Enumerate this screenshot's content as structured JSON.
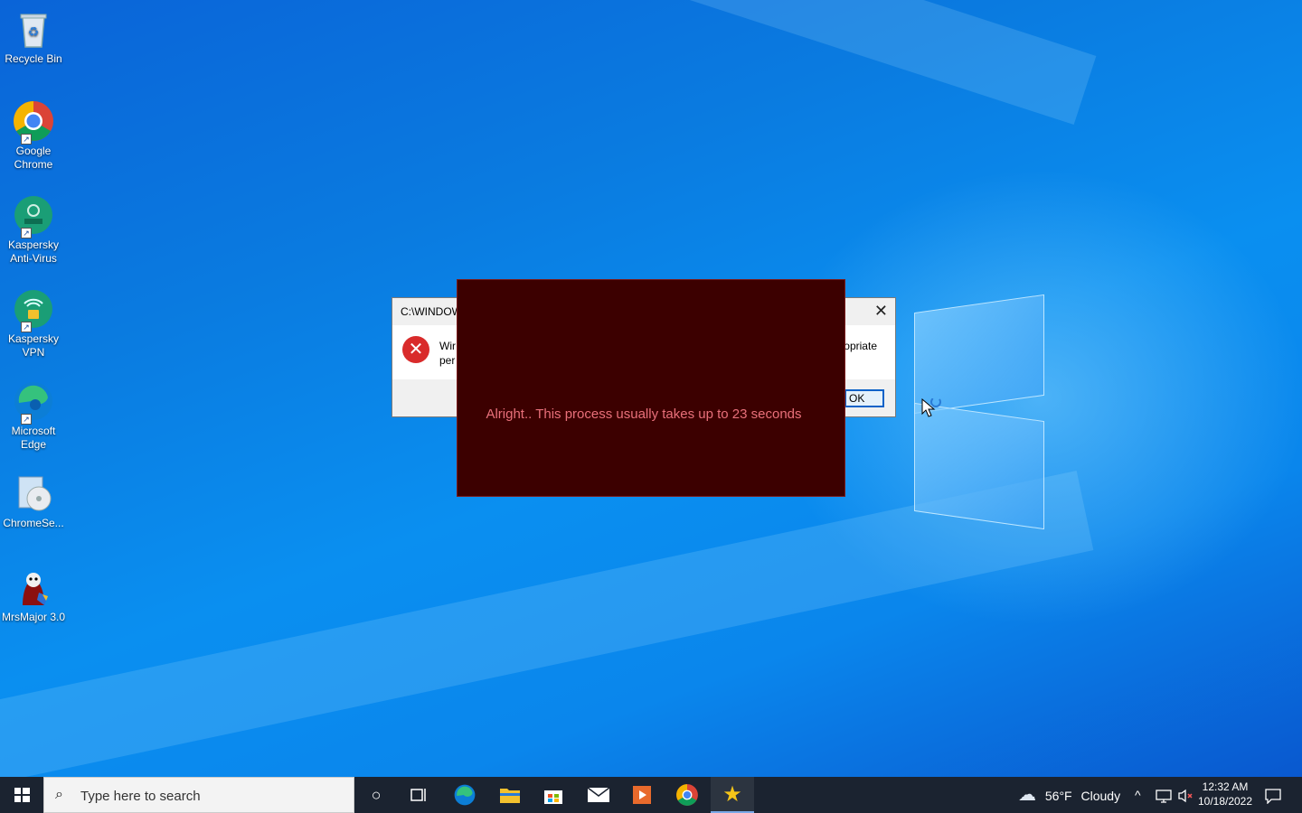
{
  "desktop": {
    "icons": [
      {
        "label": "Recycle Bin",
        "icon": "recycle-bin-icon"
      },
      {
        "label": "Google Chrome",
        "icon": "chrome-icon"
      },
      {
        "label": "Kaspersky Anti-Virus",
        "icon": "kaspersky-icon"
      },
      {
        "label": "Kaspersky VPN",
        "icon": "kaspersky-vpn-icon"
      },
      {
        "label": "Microsoft Edge",
        "icon": "edge-icon"
      },
      {
        "label": "ChromeSe...",
        "icon": "installer-icon"
      },
      {
        "label": "MrsMajor 3.0",
        "icon": "mrsmajor-icon"
      }
    ]
  },
  "error_dialog": {
    "title": "C:\\WINDOW",
    "line1": "Wir",
    "line2": "per",
    "line3": "opriate",
    "ok_label": "OK",
    "close_glyph": "✕"
  },
  "overlay": {
    "message": "Alright.. This process usually takes up to 23 seconds",
    "bg_color": "#3c0000",
    "text_color": "#e8707a"
  },
  "taskbar": {
    "search_placeholder": "Type here to search",
    "pinned": [
      "cortana-icon",
      "task-view-icon",
      "edge-icon",
      "file-explorer-icon",
      "store-icon",
      "mail-icon",
      "media-player-icon",
      "chrome-icon",
      "star-app-icon"
    ],
    "weather": {
      "temp": "56°F",
      "condition": "Cloudy"
    },
    "clock": {
      "time": "12:32 AM",
      "date": "10/18/2022"
    }
  }
}
